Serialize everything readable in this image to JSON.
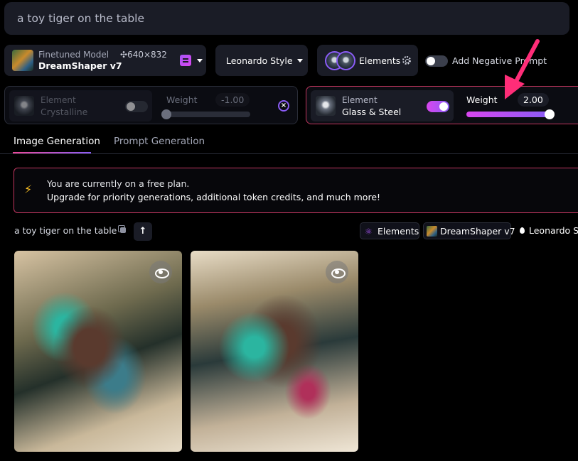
{
  "prompt": {
    "text": "a toy tiger on the table"
  },
  "model": {
    "label": "Finetuned Model",
    "name": "DreamShaper v7",
    "size": "✣640×832"
  },
  "style": {
    "label": "Leonardo Style"
  },
  "elements_button": {
    "label": "Elements"
  },
  "negative_prompt": {
    "label": "Add Negative Prompt"
  },
  "element_cards": [
    {
      "label": "Element",
      "name": "Crystalline",
      "weight_label": "Weight",
      "weight_value": "-1.00",
      "enabled": false,
      "close": "×"
    },
    {
      "label": "Element",
      "name": "Glass & Steel",
      "weight_label": "Weight",
      "weight_value": "2.00",
      "enabled": true
    }
  ],
  "tabs": [
    {
      "label": "Image Generation"
    },
    {
      "label": "Prompt Generation"
    }
  ],
  "banner": {
    "line1": "You are currently on a free plan.",
    "line2": "Upgrade for priority generations, additional token credits, and much more!"
  },
  "generation": {
    "prompt": "a toy tiger on the table",
    "up_symbol": "↑",
    "chips": {
      "elements": "Elements",
      "model": "DreamShaper v7",
      "style": "Leonardo Style"
    }
  },
  "icons": {
    "bolt": "⚡",
    "atom": "⚛",
    "list": [
      "model-thumbnail-icon",
      "edit-icon",
      "chevron-down-icon",
      "element-avatar-icon",
      "gear-icon",
      "element-thumbnail-icon",
      "close-icon",
      "lightning-bolt-icon",
      "copy-icon",
      "arrow-up-icon",
      "atom-icon",
      "drop-icon",
      "eye-icon",
      "arrow-annotation-icon"
    ]
  },
  "colors": {
    "accent_pink": "#d946ef",
    "accent_purple": "#8b5cf6",
    "alert_border": "#c0365e",
    "arrow": "#ff2d78",
    "panel_bg": "#1a1c26"
  }
}
